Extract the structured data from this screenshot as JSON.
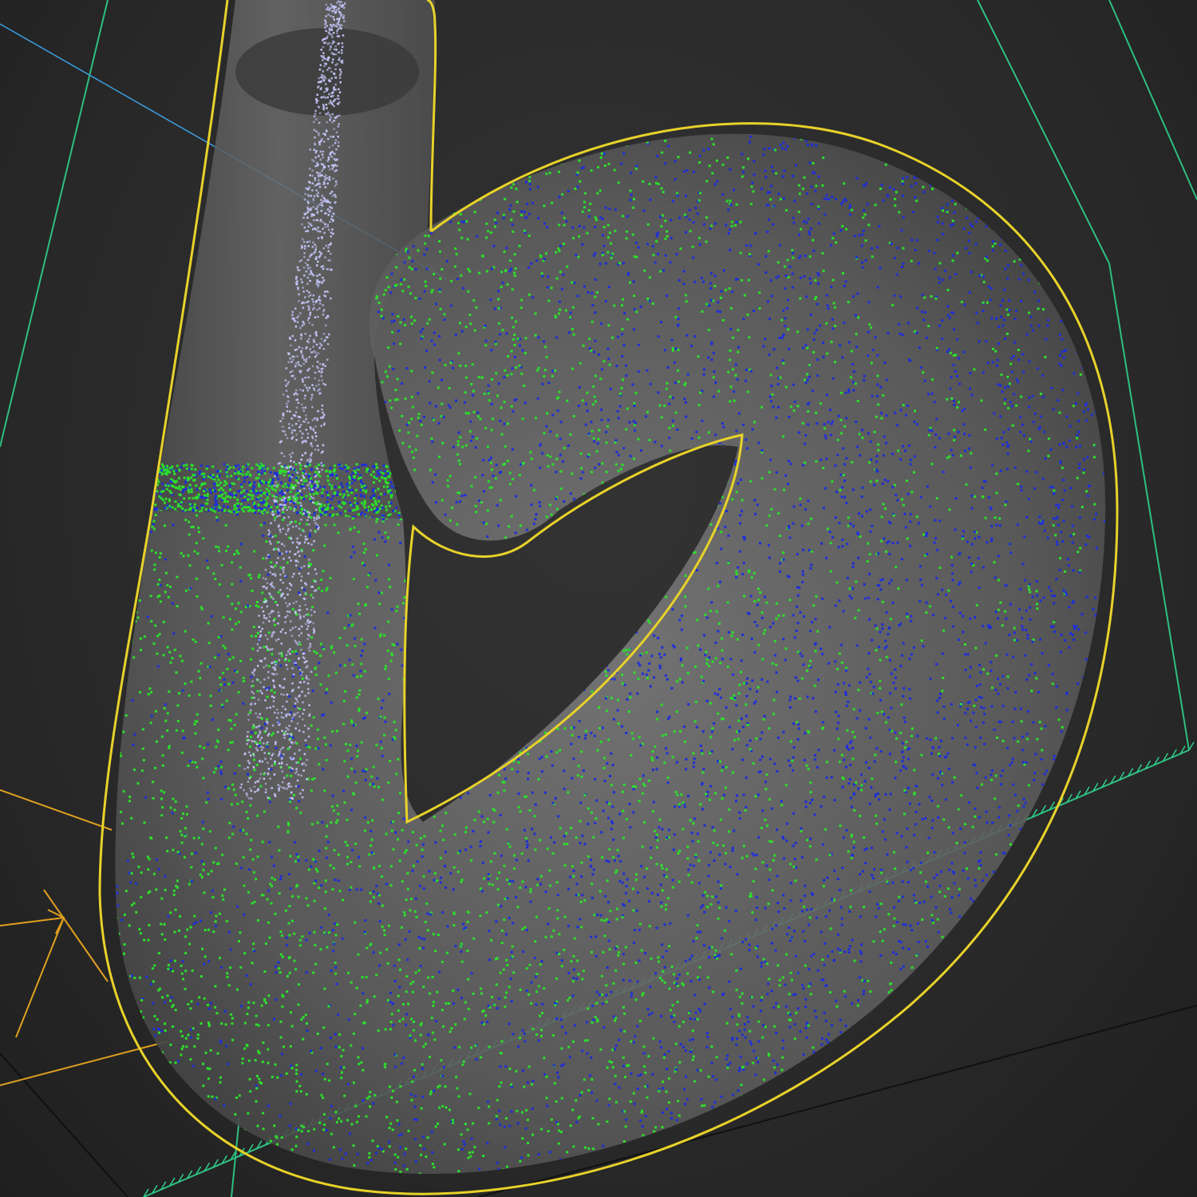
{
  "viewport": {
    "background": "#2b2b2b",
    "render_mode": "perspective"
  },
  "colors": {
    "container_outline": "#e8d22a",
    "domain_box_edges": "#2fd08a",
    "ray_line": "#3aa0e0",
    "emitter_axes": "#e0a020",
    "particles_primary": "#1e2fd8",
    "particles_secondary": "#2be02b",
    "emitter_stream": "#c8c8ff",
    "container_surface": "#6a6a6a"
  },
  "scene": {
    "container_shape": "letter-b-tube",
    "particle_groups": [
      "particles_primary",
      "particles_secondary",
      "emitter_stream"
    ],
    "axis_gizmo_icon": "axis-arrow-icon"
  }
}
